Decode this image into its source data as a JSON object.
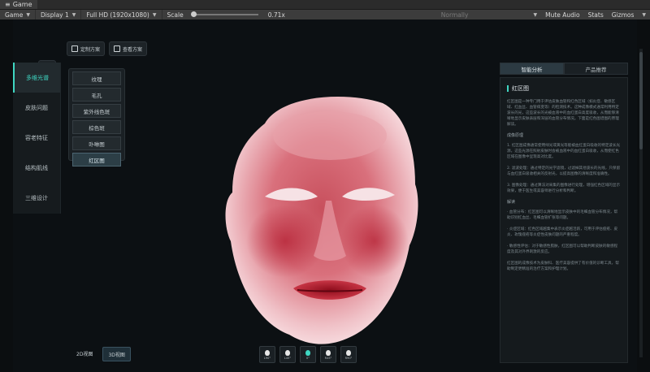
{
  "titlebar": {
    "tab_label": "Game"
  },
  "toolbar": {
    "view": "Game",
    "display": "Display 1",
    "resolution": "Full HD (1920x1080)",
    "scale_label": "Scale",
    "scale_value": "0.71x",
    "vsync": "Normally",
    "mute": "Mute Audio",
    "stats": "Stats",
    "gizmos": "Gizmos"
  },
  "topbar": {
    "custom_plan": "定制方案",
    "view_plan": "查看方案"
  },
  "leftnav": {
    "items": [
      {
        "label": "多维光谱"
      },
      {
        "label": "皮肤问题"
      },
      {
        "label": "容老特征"
      },
      {
        "label": "结构肌线"
      },
      {
        "label": "三维设计"
      }
    ]
  },
  "subnav": {
    "items": [
      {
        "label": "纹理"
      },
      {
        "label": "毛孔"
      },
      {
        "label": "紫外线色斑"
      },
      {
        "label": "棕色斑"
      },
      {
        "label": "卟啉图"
      },
      {
        "label": "红区图"
      }
    ],
    "active_index": 5
  },
  "views": {
    "view2d": "2D视图",
    "view3d": "3D视图"
  },
  "angles": [
    {
      "label": "L90°"
    },
    {
      "label": "L45°"
    },
    {
      "label": "0°"
    },
    {
      "label": "R45°"
    },
    {
      "label": "R90°"
    }
  ],
  "rightpanel": {
    "tab_analysis": "智能分析",
    "tab_products": "产品推荐",
    "heading": "红区图",
    "intro": "红区图是一种专门用于评估皮肤血管和红色区域（如炎症、敏感区域、红血丝、血管病变等）的检测技术。这种成像模式通常利用特定波长的光，这些波长的光被血液中的血红蛋白高度吸收，从而能够清晰地显示皮肤表层和深层的血管分布情况。下面是红色图谱图的原理解读。",
    "section1": "成像原理",
    "p1": "1. 红区图成像通常使用绿光或黄光等能被血红蛋白吸收的特定波长光源，这些光源在照射皮肤时会被血液中的血红蛋白吸收，从而使红色区域在图像中呈现高对比度。",
    "p2": "2. 滤波处理：通过特定的光学滤镜，过滤掉其他波长的光线，只保留与血红蛋白吸收相关的反射光，以提高图像的清晰度和准确性。",
    "p3": "3. 图像处理：通过算法对采集的图像进行处理，增强红色区域的显示效果，便于医生或美容师进行分析和判断。",
    "section2": "解读",
    "p4": "· 血管分布：红区图可以清晰地显示皮肤中的毛细血管分布情况，帮助识别红血丝、毛细血管扩张等问题。",
    "p5": "· 炎症区域：红色区域越集中表示炎症越活跃，可用于评估痤疮、皮炎、玫瑰痤疮等炎症性皮肤问题的严重程度。",
    "p6": "· 敏感性评估：对于敏感性肌肤，红区图可以帮助判断皮肤的敏感程度及其对外界刺激的反应。",
    "p7": "红区图的成像技术为皮肤科、医疗美容提供了有价值的诊断工具，帮助制定更精准的治疗方案和护理计划。"
  },
  "colors": {
    "accent": "#3fd6c2",
    "background": "#0b0e10"
  }
}
